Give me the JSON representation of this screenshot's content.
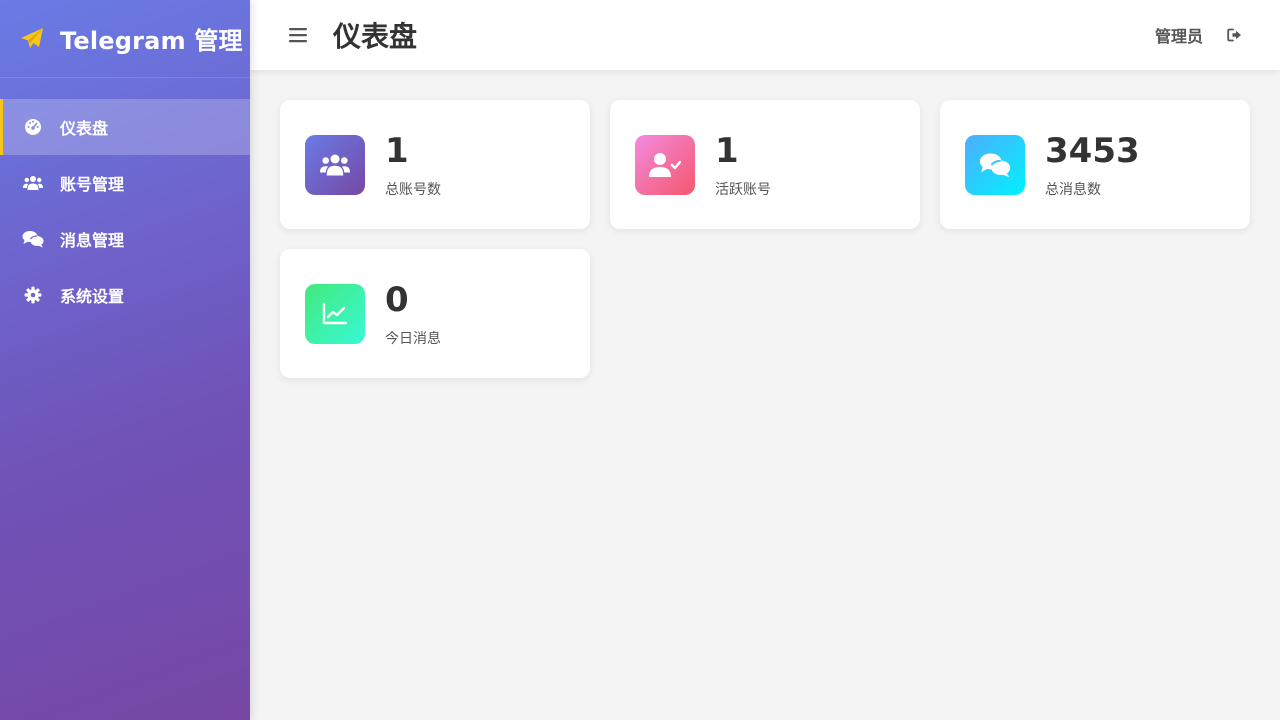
{
  "sidebar": {
    "brand": {
      "title": "Telegram 管理",
      "icon": "paper-plane-icon",
      "icon_color": "#f5c518"
    },
    "items": [
      {
        "label": "仪表盘",
        "icon": "dashboard-icon",
        "active": true
      },
      {
        "label": "账号管理",
        "icon": "users-icon",
        "active": false
      },
      {
        "label": "消息管理",
        "icon": "comments-icon",
        "active": false
      },
      {
        "label": "系统设置",
        "icon": "gear-icon",
        "active": false
      }
    ]
  },
  "header": {
    "menu_icon": "menu-icon",
    "title": "仪表盘",
    "user": "管理员",
    "logout_icon": "logout-icon"
  },
  "stats": [
    {
      "value": "1",
      "label": "总账号数",
      "icon": "users-icon",
      "color": "purple"
    },
    {
      "value": "1",
      "label": "活跃账号",
      "icon": "user-check-icon",
      "color": "pink"
    },
    {
      "value": "3453",
      "label": "总消息数",
      "icon": "comments-icon",
      "color": "blue"
    },
    {
      "value": "0",
      "label": "今日消息",
      "icon": "chart-line-icon",
      "color": "green"
    }
  ],
  "colors": {
    "sidebar_gradient_start": "#6a7be6",
    "sidebar_gradient_end": "#7648a4",
    "active_indicator": "#f5c518",
    "background": "#f4f4f4"
  }
}
